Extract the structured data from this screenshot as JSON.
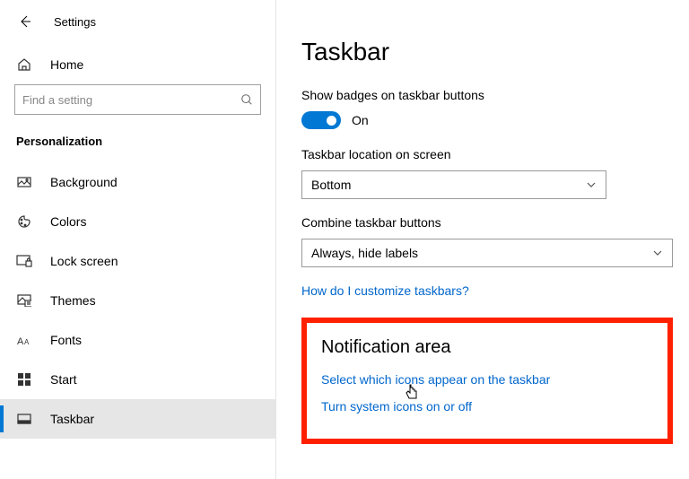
{
  "header": {
    "title": "Settings"
  },
  "sidebar": {
    "home_label": "Home",
    "search": {
      "placeholder": "Find a setting"
    },
    "section": "Personalization",
    "items": [
      {
        "label": "Background"
      },
      {
        "label": "Colors"
      },
      {
        "label": "Lock screen"
      },
      {
        "label": "Themes"
      },
      {
        "label": "Fonts"
      },
      {
        "label": "Start"
      },
      {
        "label": "Taskbar"
      }
    ]
  },
  "main": {
    "title": "Taskbar",
    "badges": {
      "label": "Show badges on taskbar buttons",
      "state": "On"
    },
    "location": {
      "label": "Taskbar location on screen",
      "value": "Bottom"
    },
    "combine": {
      "label": "Combine taskbar buttons",
      "value": "Always, hide labels"
    },
    "help_link": "How do I customize taskbars?",
    "notification": {
      "title": "Notification area",
      "link1": "Select which icons appear on the taskbar",
      "link2": "Turn system icons on or off"
    }
  }
}
